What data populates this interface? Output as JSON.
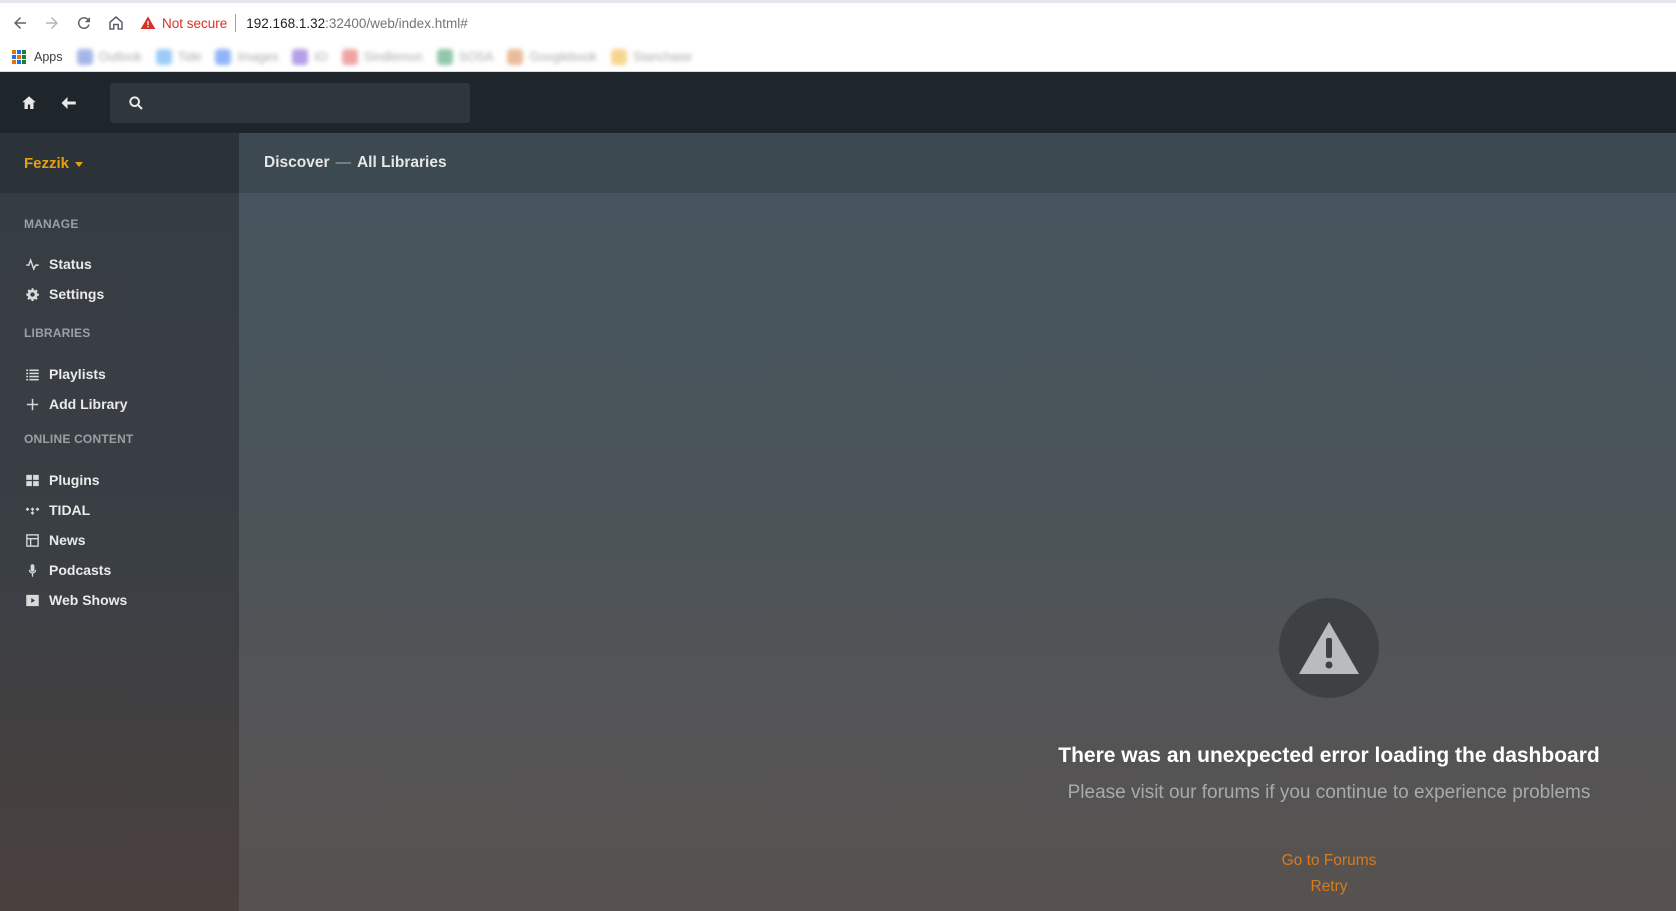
{
  "browser": {
    "security_label": "Not secure",
    "url_host": "192.168.1.32",
    "url_rest": ":32400/web/index.html#",
    "apps_label": "Apps",
    "bookmarks": [
      {
        "label": "Outlook",
        "color": "#5b7bd5"
      },
      {
        "label": "Tide",
        "color": "#4aa3f0"
      },
      {
        "label": "Images",
        "color": "#3a78f2"
      },
      {
        "label": "IO",
        "color": "#7b4fd6"
      },
      {
        "label": "Sindlemon",
        "color": "#e25a5a"
      },
      {
        "label": "SOSA",
        "color": "#3a9a6a"
      },
      {
        "label": "Googlebook",
        "color": "#d8844a"
      },
      {
        "label": "Stanchase",
        "color": "#f2b233"
      }
    ]
  },
  "topbar": {
    "search_value": "",
    "search_placeholder": ""
  },
  "sidebar": {
    "server_name": "Fezzik",
    "sections": [
      {
        "label": "MANAGE",
        "items": [
          {
            "label": "Status",
            "icon": "activity-icon"
          },
          {
            "label": "Settings",
            "icon": "gear-icon"
          }
        ]
      },
      {
        "label": "LIBRARIES",
        "items": [
          {
            "label": "Playlists",
            "icon": "list-icon"
          },
          {
            "label": "Add Library",
            "icon": "plus-icon"
          }
        ]
      },
      {
        "label": "ONLINE CONTENT",
        "items": [
          {
            "label": "Plugins",
            "icon": "grid-icon"
          },
          {
            "label": "TIDAL",
            "icon": "tidal-icon"
          },
          {
            "label": "News",
            "icon": "news-icon"
          },
          {
            "label": "Podcasts",
            "icon": "microphone-icon"
          },
          {
            "label": "Web Shows",
            "icon": "play-icon"
          }
        ]
      }
    ]
  },
  "main": {
    "breadcrumb": {
      "first": "Discover",
      "separator": "—",
      "second": "All Libraries"
    },
    "error": {
      "title": "There was an unexpected error loading the dashboard",
      "subtitle": "Please visit our forums if you continue to experience problems",
      "forums_link": "Go to Forums",
      "retry_link": "Retry"
    }
  },
  "colors": {
    "accent": "#e5a00d",
    "link": "#d77b1c",
    "warning": "#d93025"
  }
}
